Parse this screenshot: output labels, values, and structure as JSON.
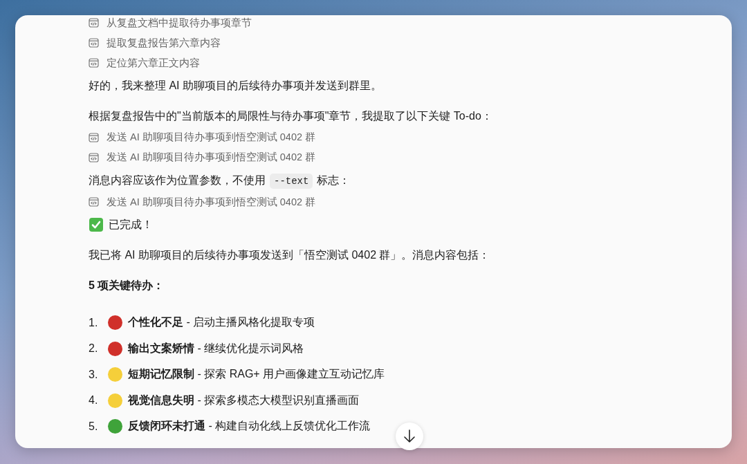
{
  "blocks": [
    {
      "kind": "tool",
      "text": "从复盘文档中提取待办事项章节"
    },
    {
      "kind": "tool",
      "text": "提取复盘报告第六章内容"
    },
    {
      "kind": "tool",
      "text": "定位第六章正文内容"
    },
    {
      "kind": "text",
      "text": "好的，我来整理 AI 助聊项目的后续待办事项并发送到群里。"
    },
    {
      "kind": "text",
      "text": "根据复盘报告中的\"当前版本的局限性与待办事项\"章节，我提取了以下关键 To-do："
    },
    {
      "kind": "tool",
      "text": "发送 AI 助聊项目待办事项到悟空测试 0402 群"
    },
    {
      "kind": "tool",
      "text": "发送 AI 助聊项目待办事项到悟空测试 0402 群"
    },
    {
      "kind": "text_code",
      "before": "消息内容应该作为位置参数，不使用",
      "code": "--text",
      "after": "标志："
    },
    {
      "kind": "tool",
      "text": "发送 AI 助聊项目待办事项到悟空测试 0402 群"
    },
    {
      "kind": "done",
      "text": "已完成！"
    },
    {
      "kind": "text",
      "text": "我已将 AI 助聊项目的后续待办事项发送到「悟空测试 0402 群」。消息内容包括："
    },
    {
      "kind": "heading",
      "text": "5 项关键待办："
    },
    {
      "kind": "list",
      "items": [
        {
          "number": "1.",
          "color": "#d0302a",
          "title": "个性化不足",
          "detail": "- 启动主播风格化提取专项"
        },
        {
          "number": "2.",
          "color": "#d0302a",
          "title": "输出文案矫情",
          "detail": "- 继续优化提示词风格"
        },
        {
          "number": "3.",
          "color": "#f5cf3a",
          "title": "短期记忆限制",
          "detail": "- 探索 RAG+ 用户画像建立互动记忆库"
        },
        {
          "number": "4.",
          "color": "#f5cf3a",
          "title": "视觉信息失明",
          "detail": "- 探索多模态大模型识别直播画面"
        },
        {
          "number": "5.",
          "color": "#3fa33a",
          "title": "反馈闭环未打通",
          "detail": "- 构建自动化线上反馈优化工作流"
        }
      ]
    }
  ]
}
